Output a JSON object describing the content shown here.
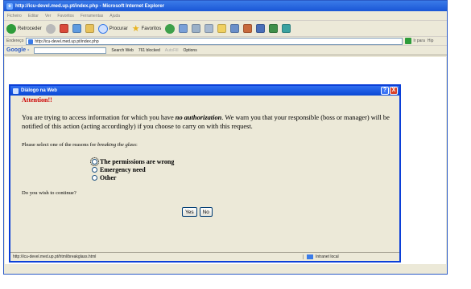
{
  "browser": {
    "title": "http://icu-devel.med.up.pt/index.php - Microsoft Internet Explorer",
    "menu": [
      "Ficheiro",
      "Editar",
      "Ver",
      "Favoritos",
      "Ferramentas",
      "Ajuda"
    ],
    "toolbar": {
      "back_label": "Retroceder",
      "search_label": "Procurar",
      "favorites_label": "Favoritos"
    },
    "address": {
      "label": "Endereço",
      "url": "http://icu-devel.med.up.pt/index.php",
      "go_label": "Ir para",
      "links_label": "Hip"
    },
    "google": {
      "logo": "Google -",
      "search_web": "Search Web",
      "blocked": "761 blocked",
      "autofill": "AutoFill",
      "options": "Options"
    }
  },
  "dialog": {
    "title": "Diálogo na Web",
    "help": "?",
    "close": "X",
    "attention": "Attention!!",
    "warning_pre": "You are trying to access information for which you have ",
    "warning_em": "no authorization",
    "warning_post": ". We warn you that your responsible (boss or manager) will be notified of this action (acting accordingly) if you choose to carry on with this request.",
    "select_pre": "Please select one of the reasons for ",
    "select_em": "breaking the glass",
    "select_post": ":",
    "options": [
      "The permissions are wrong",
      "Emergency need",
      "Other"
    ],
    "continue": "Do you wish to continue?",
    "yes": "Yes",
    "no": "No",
    "status_url": "http://icu-devel.med.up.pt/html/breakglass.html",
    "zone": "Intranet local"
  }
}
